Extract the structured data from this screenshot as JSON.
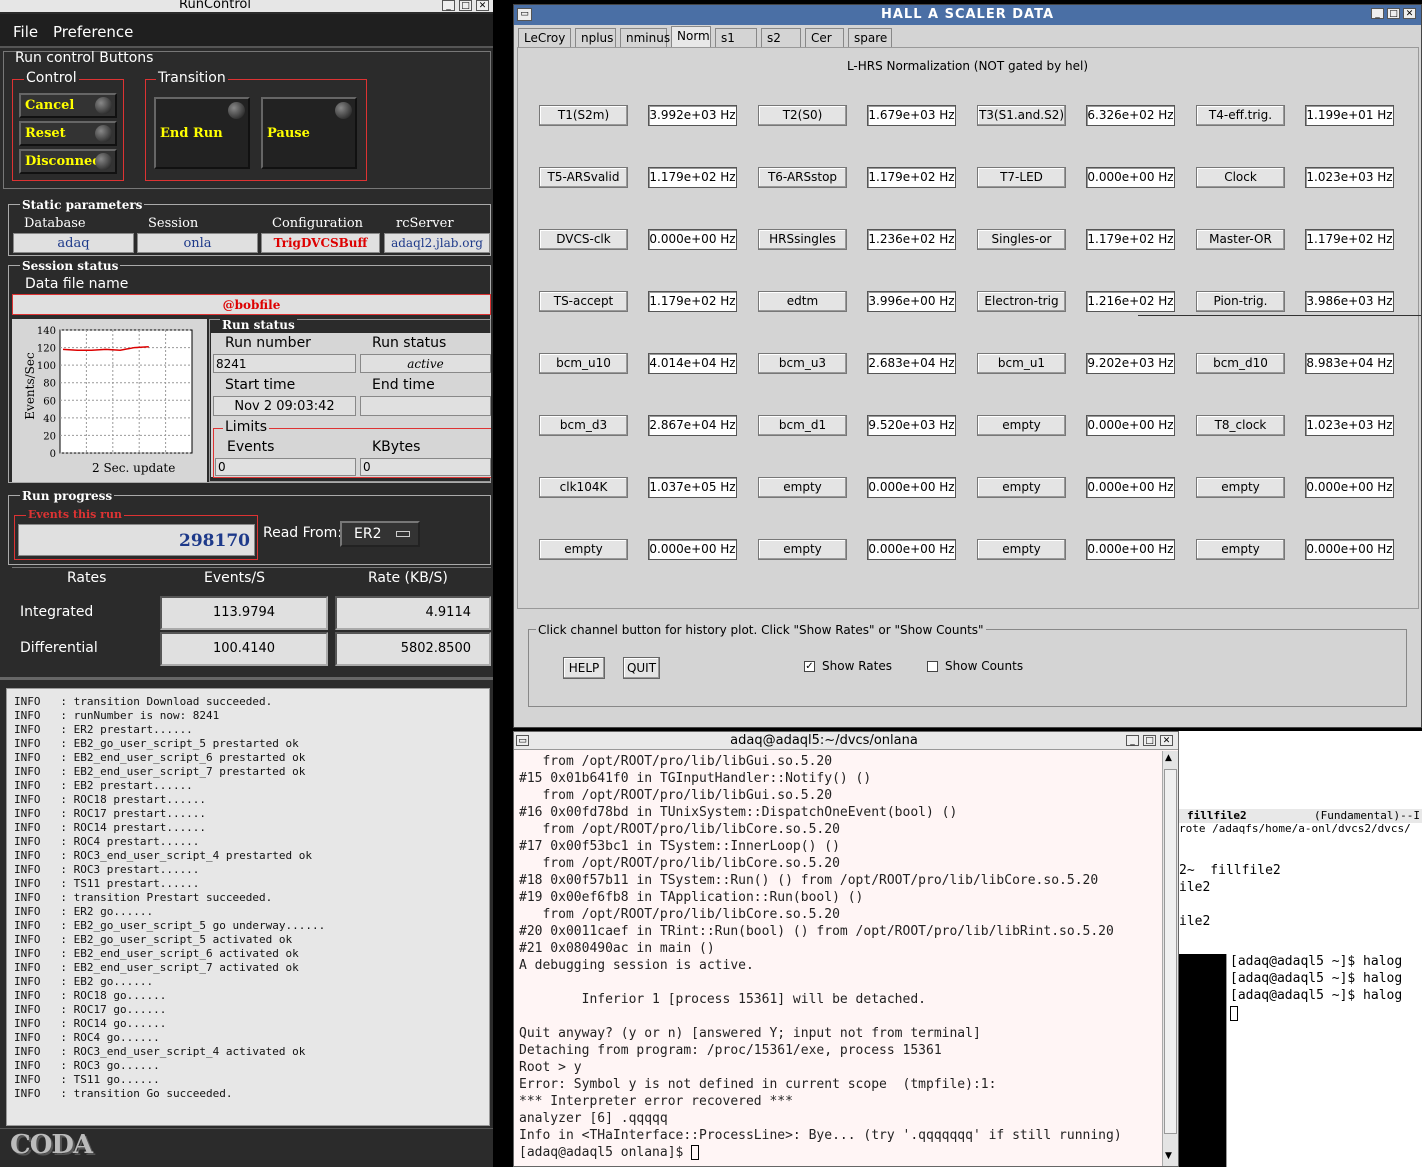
{
  "runcontrol": {
    "title": "RunControl",
    "menu": {
      "file": "File",
      "preference": "Preference"
    },
    "run_control_buttons_title": "Run control Buttons",
    "control_title": "Control",
    "transition_title": "Transition",
    "cancel": "Cancel",
    "reset": "Reset",
    "disconnect": "Disconnect",
    "end_run": "End Run",
    "pause": "Pause",
    "static_params_title": "Static parameters",
    "database_label": "Database",
    "database_value": "adaq",
    "session_label": "Session",
    "session_value": "onla",
    "configuration_label": "Configuration",
    "configuration_value": "TrigDVCSBuff",
    "rcserver_label": "rcServer",
    "rcserver_value": "adaql2.jlab.org",
    "session_status_title": "Session status",
    "data_file_label": "Data file name",
    "data_file_value": "@bobfile",
    "plot": {
      "ylabel": "Events/Sec",
      "yticks": [
        "140",
        "120",
        "100",
        "80",
        "60",
        "40",
        "20",
        "0"
      ],
      "update": "2 Sec. update",
      "values": [
        118,
        117,
        117,
        118,
        117,
        120,
        121
      ]
    },
    "run_status_title": "Run status",
    "run_number_label": "Run number",
    "run_number": "8241",
    "run_status_label": "Run status",
    "run_status": "active",
    "start_time_label": "Start time",
    "start_time": "Nov 2 09:03:42",
    "end_time_label": "End time",
    "end_time": "",
    "limits_title": "Limits",
    "events_label": "Events",
    "events_limit": "0",
    "kbytes_label": "KBytes",
    "kbytes_limit": "0",
    "run_progress_title": "Run progress",
    "events_this_run_label": "Events this run",
    "events_this_run": "298170",
    "read_from_label": "Read From:",
    "read_from_value": "ER2",
    "rates_header": "Rates",
    "events_s_header": "Events/S",
    "rate_kbs_header": "Rate (KB/S)",
    "integrated_label": "Integrated",
    "integrated_events": "113.9794",
    "integrated_rate": "4.9114",
    "differential_label": "Differential",
    "differential_events": "100.4140",
    "differential_rate": "5802.8500",
    "log": [
      "INFO   : transition Download succeeded.",
      "INFO   : runNumber is now: 8241",
      "INFO   : ER2 prestart......",
      "INFO   : EB2_go_user_script_5 prestarted ok",
      "INFO   : EB2_end_user_script_6 prestarted ok",
      "INFO   : EB2_end_user_script_7 prestarted ok",
      "INFO   : EB2 prestart......",
      "INFO   : ROC18 prestart......",
      "INFO   : ROC17 prestart......",
      "INFO   : ROC14 prestart......",
      "INFO   : ROC4 prestart......",
      "INFO   : ROC3_end_user_script_4 prestarted ok",
      "INFO   : ROC3 prestart......",
      "INFO   : TS11 prestart......",
      "INFO   : transition Prestart succeeded.",
      "INFO   : ER2 go......",
      "INFO   : EB2_go_user_script_5 go underway......",
      "INFO   : EB2_go_user_script_5 activated ok",
      "INFO   : EB2_end_user_script_6 activated ok",
      "INFO   : EB2_end_user_script_7 activated ok",
      "INFO   : EB2 go......",
      "INFO   : ROC18 go......",
      "INFO   : ROC17 go......",
      "INFO   : ROC14 go......",
      "INFO   : ROC4 go......",
      "INFO   : ROC3_end_user_script_4 activated ok",
      "INFO   : ROC3 go......",
      "INFO   : TS11 go......",
      "INFO   : transition Go succeeded."
    ],
    "logo": "CODA"
  },
  "scaler": {
    "title": "HALL  A  SCALER  DATA",
    "tabs": [
      "LeCroy",
      "nplus",
      "nminus",
      "Norm",
      "s1",
      "s2",
      "Cer",
      "spare"
    ],
    "active_tab": "Norm",
    "heading": "L-HRS Normalization (NOT gated by hel)",
    "rows": [
      [
        [
          "T1(S2m)",
          "3.992e+03 Hz"
        ],
        [
          "T2(S0)",
          "1.679e+03 Hz"
        ],
        [
          "T3(S1.and.S2)",
          "6.326e+02 Hz"
        ],
        [
          "T4-eff.trig.",
          "1.199e+01 Hz"
        ]
      ],
      [
        [
          "T5-ARSvalid",
          "1.179e+02 Hz"
        ],
        [
          "T6-ARSstop",
          "1.179e+02 Hz"
        ],
        [
          "T7-LED",
          "0.000e+00 Hz"
        ],
        [
          "Clock",
          "1.023e+03 Hz"
        ]
      ],
      [
        [
          "DVCS-clk",
          "0.000e+00 Hz"
        ],
        [
          "HRSsingles",
          "1.236e+02 Hz"
        ],
        [
          "Singles-or",
          "1.179e+02 Hz"
        ],
        [
          "Master-OR",
          "1.179e+02 Hz"
        ]
      ],
      [
        [
          "TS-accept",
          "1.179e+02 Hz"
        ],
        [
          "edtm",
          "3.996e+00 Hz"
        ],
        [
          "Electron-trig",
          "1.216e+02 Hz"
        ],
        [
          "Pion-trig.",
          "3.986e+03 Hz"
        ]
      ],
      [
        [
          "bcm_u10",
          "4.014e+04 Hz"
        ],
        [
          "bcm_u3",
          "2.683e+04 Hz"
        ],
        [
          "bcm_u1",
          "9.202e+03 Hz"
        ],
        [
          "bcm_d10",
          "8.983e+04 Hz"
        ]
      ],
      [
        [
          "bcm_d3",
          "2.867e+04 Hz"
        ],
        [
          "bcm_d1",
          "9.520e+03 Hz"
        ],
        [
          "empty",
          "0.000e+00 Hz"
        ],
        [
          "T8_clock",
          "1.023e+03 Hz"
        ]
      ],
      [
        [
          "clk104K",
          "1.037e+05 Hz"
        ],
        [
          "empty",
          "0.000e+00 Hz"
        ],
        [
          "empty",
          "0.000e+00 Hz"
        ],
        [
          "empty",
          "0.000e+00 Hz"
        ]
      ],
      [
        [
          "empty",
          "0.000e+00 Hz"
        ],
        [
          "empty",
          "0.000e+00 Hz"
        ],
        [
          "empty",
          "0.000e+00 Hz"
        ],
        [
          "empty",
          "0.000e+00 Hz"
        ]
      ]
    ],
    "help_text": "Click channel button for history plot.  Click \"Show Rates\" or \"Show Counts\"",
    "help_button": "HELP",
    "quit_button": "QUIT",
    "show_rates": "Show Rates",
    "show_counts": "Show Counts"
  },
  "xterm": {
    "title": "adaq@adaql5:~/dvcs/onlana",
    "lines": [
      "   from /opt/ROOT/pro/lib/libGui.so.5.20",
      "#15 0x01b641f0 in TGInputHandler::Notify() ()",
      "   from /opt/ROOT/pro/lib/libGui.so.5.20",
      "#16 0x00fd78bd in TUnixSystem::DispatchOneEvent(bool) ()",
      "   from /opt/ROOT/pro/lib/libCore.so.5.20",
      "#17 0x00f53bc1 in TSystem::InnerLoop() ()",
      "   from /opt/ROOT/pro/lib/libCore.so.5.20",
      "#18 0x00f57b11 in TSystem::Run() () from /opt/ROOT/pro/lib/libCore.so.5.20",
      "#19 0x00ef6fb8 in TApplication::Run(bool) ()",
      "   from /opt/ROOT/pro/lib/libCore.so.5.20",
      "#20 0x0011caef in TRint::Run(bool) () from /opt/ROOT/pro/lib/libRint.so.5.20",
      "#21 0x080490ac in main ()",
      "A debugging session is active.",
      "",
      "        Inferior 1 [process 15361] will be detached.",
      "",
      "Quit anyway? (y or n) [answered Y; input not from terminal]",
      "Detaching from program: /proc/15361/exe, process 15361",
      "Root > y",
      "Error: Symbol y is not defined in current scope  (tmpfile):1:",
      "*** Interpreter error recovered ***",
      "analyzer [6] .qqqqq",
      "Info in <THaInterface::ProcessLine>: Bye... (try '.qqqqqqq' if still running)",
      "[adaq@adaql5 onlana]$ "
    ]
  },
  "emacs": {
    "modeline_name": "fillfile2",
    "modeline_mode": "(Fundamental)--I",
    "path": "rote /adaqfs/home/a-onl/dvcs2/dvcs/",
    "lines": [
      "2~  fillfile2",
      "ile2",
      "",
      "ile2"
    ]
  },
  "bgterm": {
    "lines": [
      "[adaq@adaql5 ~]$ halog",
      "[adaq@adaql5 ~]$ halog",
      "[adaq@adaql5 ~]$ halog"
    ]
  }
}
